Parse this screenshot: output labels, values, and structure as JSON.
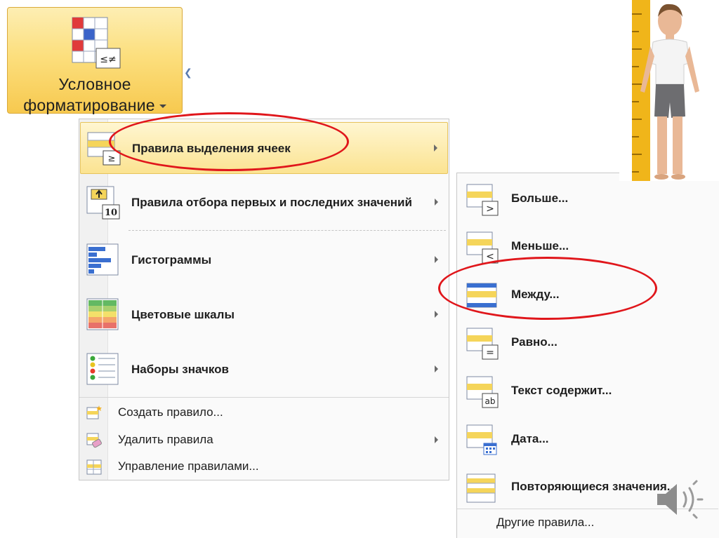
{
  "ribbon": {
    "button_line1": "Условное",
    "button_line2": "форматирование"
  },
  "menu": {
    "items": [
      {
        "label": "Правила выделения ячеек",
        "icon": "highlight-rules-icon",
        "submenu": true
      },
      {
        "label": "Правила отбора первых и последних значений",
        "icon": "top-bottom-rules-icon",
        "submenu": true
      },
      {
        "label": "Гистограммы",
        "icon": "data-bars-icon",
        "submenu": true
      },
      {
        "label": "Цветовые шкалы",
        "icon": "color-scales-icon",
        "submenu": true
      },
      {
        "label": "Наборы значков",
        "icon": "icon-sets-icon",
        "submenu": true
      }
    ],
    "small_items": [
      {
        "label": "Создать правило...",
        "icon": "new-rule-icon"
      },
      {
        "label": "Удалить правила",
        "icon": "clear-rules-icon"
      },
      {
        "label": "Управление правилами...",
        "icon": "manage-rules-icon"
      }
    ],
    "top_bottom_badge": "10"
  },
  "submenu": {
    "items": [
      {
        "label": "Больше...",
        "symbol": ">"
      },
      {
        "label": "Меньше...",
        "symbol": "<"
      },
      {
        "label": "Между...",
        "symbol": ""
      },
      {
        "label": "Равно...",
        "symbol": "="
      },
      {
        "label": "Текст содержит...",
        "symbol": "ab"
      },
      {
        "label": "Дата...",
        "symbol": ""
      },
      {
        "label": "Повторяющиеся значения...",
        "symbol": ""
      }
    ],
    "other": "Другие правила..."
  },
  "colors": {
    "highlight": "#fbe391",
    "annotation_red": "#e0161b",
    "ribbon_gold": "#f7c94f"
  }
}
